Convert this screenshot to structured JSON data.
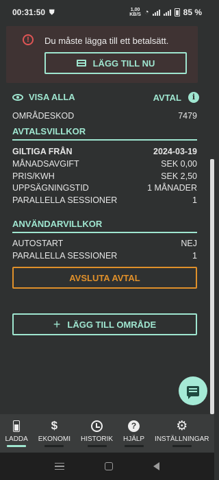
{
  "status_bar": {
    "time": "00:31:50",
    "net_speed_value": "1,00",
    "net_speed_unit": "KB/S",
    "battery": "85 %"
  },
  "alert": {
    "message": "Du måste lägga till ett betalsätt.",
    "button_label": "LÄGG TILL NU"
  },
  "header": {
    "show_all_label": "VISA ALLA",
    "agreement_label": "AVTAL"
  },
  "area_code": {
    "label": "OMRÅDESKOD",
    "value": "7479"
  },
  "agreement_terms": {
    "title": "AVTALSVILLKOR",
    "rows": [
      {
        "label": "GILTIGA FRÅN",
        "value": "2024-03-19"
      },
      {
        "label": "MÅNADSAVGIFT",
        "value": "SEK 0,00"
      },
      {
        "label": "PRIS/KWH",
        "value": "SEK 2,50"
      },
      {
        "label": "UPPSÄGNINGSTID",
        "value": "1 MÅNADER"
      },
      {
        "label": "PARALLELLA SESSIONER",
        "value": "1"
      }
    ]
  },
  "user_terms": {
    "title": "ANVÄNDARVILLKOR",
    "rows": [
      {
        "label": "AUTOSTART",
        "value": "NEJ"
      },
      {
        "label": "PARALLELLA SESSIONER",
        "value": "1"
      }
    ]
  },
  "actions": {
    "end_agreement": "AVSLUTA AVTAL",
    "add_area": "LÄGG TILL OMRÅDE"
  },
  "bottom_nav": [
    {
      "label": "LADDA",
      "icon": "charging-icon",
      "active": true
    },
    {
      "label": "EKONOMI",
      "icon": "dollar-icon",
      "active": false
    },
    {
      "label": "HISTORIK",
      "icon": "history-icon",
      "active": false
    },
    {
      "label": "HJÄLP",
      "icon": "help-icon",
      "active": false
    },
    {
      "label": "INSTÄLLNINGAR",
      "icon": "gear-icon",
      "active": false
    }
  ],
  "colors": {
    "background": "#2f3131",
    "accent": "#9fe6d0",
    "warning": "#e0902a",
    "error": "#e05555"
  }
}
